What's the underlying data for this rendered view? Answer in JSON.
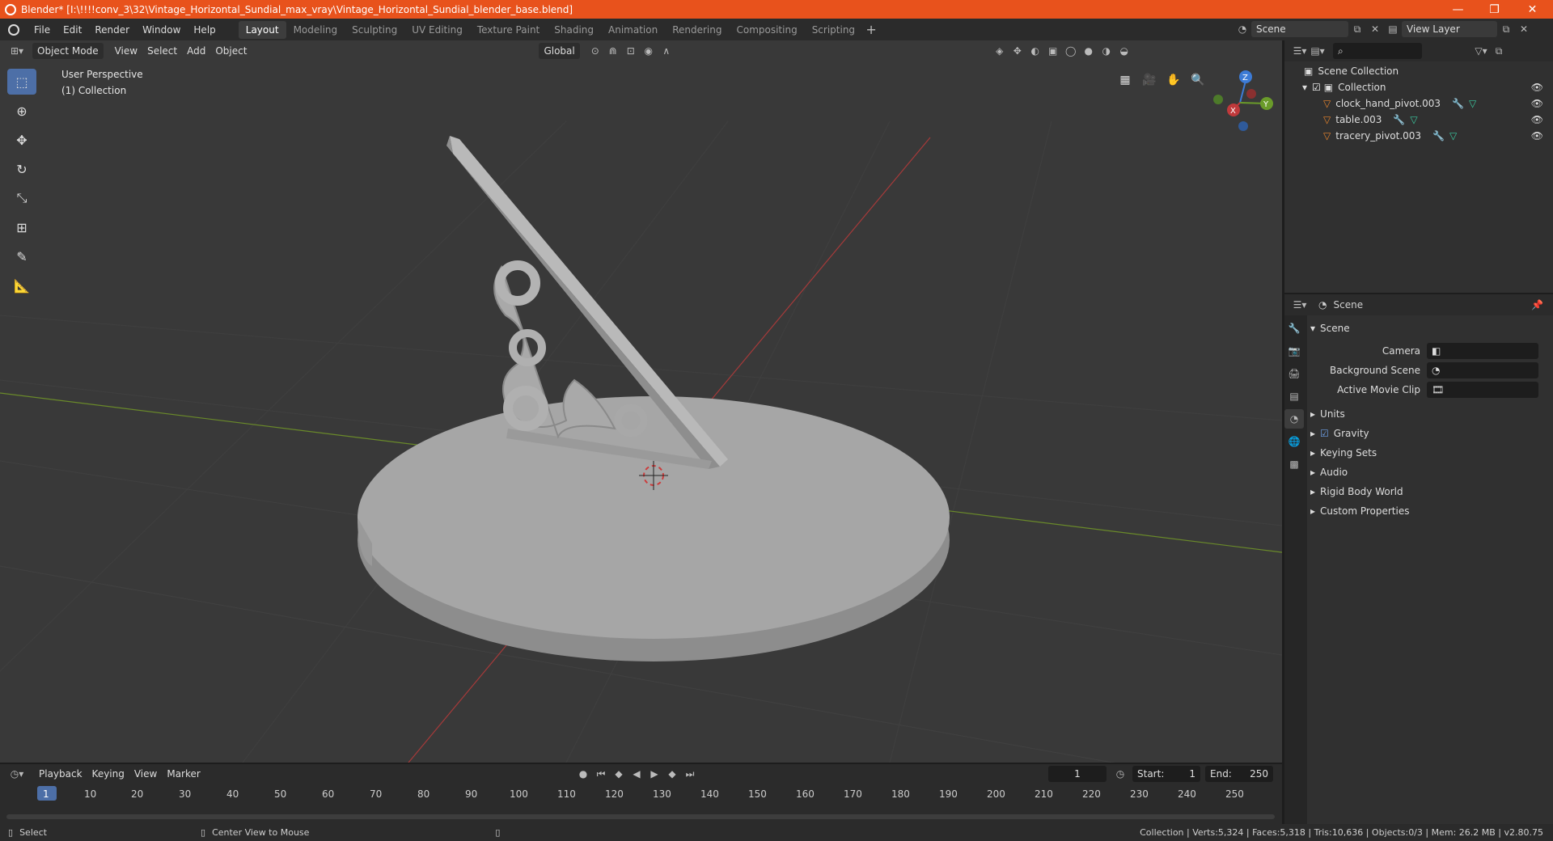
{
  "window": {
    "title": "Blender* [I:\\!!!!conv_3\\32\\Vintage_Horizontal_Sundial_max_vray\\Vintage_Horizontal_Sundial_blender_base.blend]",
    "minimize": "—",
    "maximize": "❐",
    "close": "✕"
  },
  "menu": {
    "file": "File",
    "edit": "Edit",
    "render": "Render",
    "window": "Window",
    "help": "Help"
  },
  "workspaces": [
    "Layout",
    "Modeling",
    "Sculpting",
    "UV Editing",
    "Texture Paint",
    "Shading",
    "Animation",
    "Rendering",
    "Compositing",
    "Scripting"
  ],
  "scene_field": "Scene",
  "view_layer_field": "View Layer",
  "viewport": {
    "mode": "Object Mode",
    "view": "View",
    "select": "Select",
    "add": "Add",
    "object": "Object",
    "orientation": "Global",
    "overlay_line1": "User Perspective",
    "overlay_line2": "(1) Collection",
    "gizmo": {
      "x": "X",
      "y": "Y",
      "z": "Z"
    }
  },
  "outliner": {
    "root": "Scene Collection",
    "collection": "Collection",
    "items": [
      "clock_hand_pivot.003",
      "table.003",
      "tracery_pivot.003"
    ]
  },
  "properties": {
    "header": "Scene",
    "panel": "Scene",
    "camera_label": "Camera",
    "background_label": "Background Scene",
    "movieclip_label": "Active Movie Clip",
    "sections": [
      "Units",
      "Gravity",
      "Keying Sets",
      "Audio",
      "Rigid Body World",
      "Custom Properties"
    ]
  },
  "timeline": {
    "playback": "Playback",
    "keying": "Keying",
    "view": "View",
    "marker": "Marker",
    "current_frame": "1",
    "start_label": "Start:",
    "start": "1",
    "end_label": "End:",
    "end": "250",
    "ticks": [
      "1",
      "10",
      "20",
      "30",
      "40",
      "50",
      "60",
      "70",
      "80",
      "90",
      "100",
      "110",
      "120",
      "130",
      "140",
      "150",
      "160",
      "170",
      "180",
      "190",
      "200",
      "210",
      "220",
      "230",
      "240",
      "250"
    ]
  },
  "status": {
    "left": "Select",
    "middle": "Center View to Mouse",
    "right": "Collection | Verts:5,324 | Faces:5,318 | Tris:10,636 | Objects:0/3 | Mem: 26.2 MB | v2.80.75"
  },
  "colors": {
    "accent": "#4d6fa7",
    "title_bar": "#e8521c",
    "x_axis": "#c0393b",
    "y_axis": "#6a9b2a",
    "z_axis": "#3c7bd6"
  }
}
